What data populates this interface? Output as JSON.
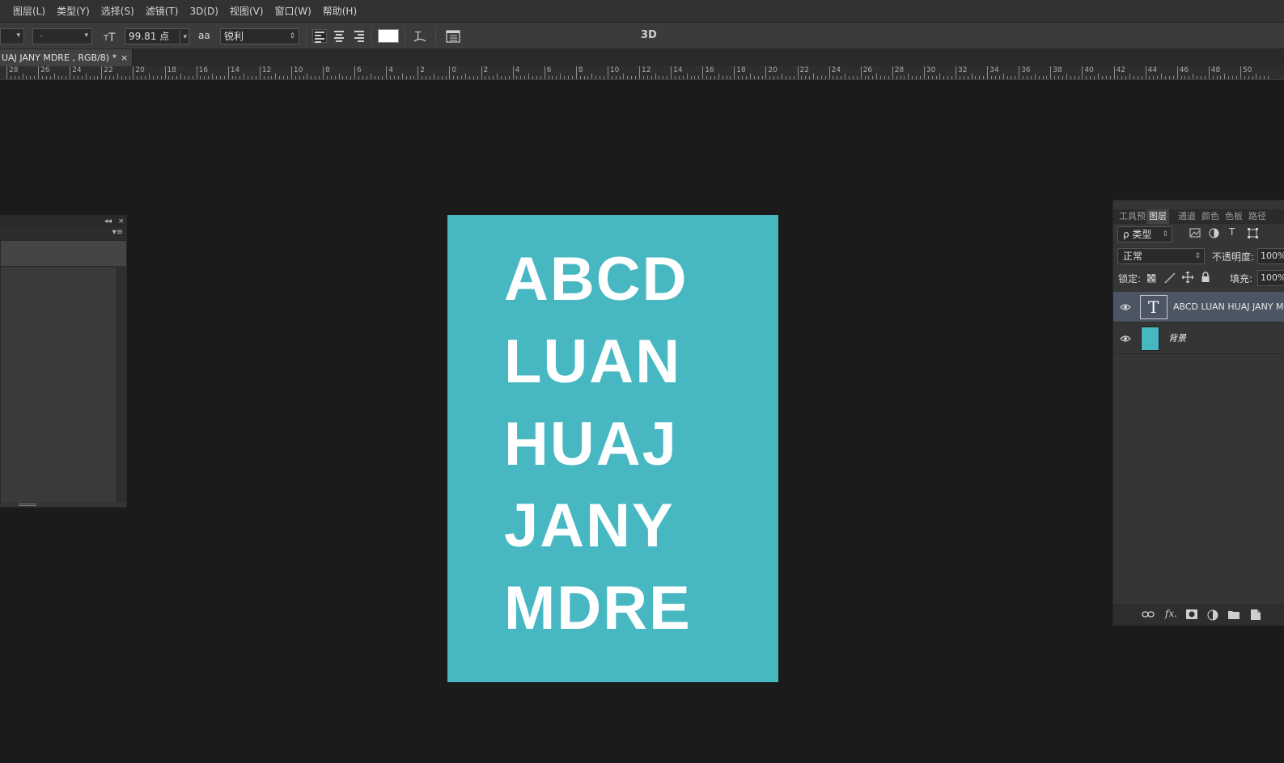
{
  "menubar": {
    "items": [
      "图层(L)",
      "类型(Y)",
      "选择(S)",
      "滤镜(T)",
      "3D(D)",
      "视图(V)",
      "窗口(W)",
      "帮助(H)"
    ]
  },
  "options": {
    "font_style_value": "-",
    "font_size_value": "99.81 点",
    "aa_icon": "aa",
    "antialias_value": "锐利",
    "text_color": "#ffffff",
    "mode_3d_label": "3D"
  },
  "document": {
    "tab_title": "UAJ JANY  MDRE , RGB/8) *",
    "tab_close": "×",
    "background_color": "#47b8c2",
    "lines": [
      "ABCD",
      "LUAN",
      "HUAJ",
      "JANY",
      "MDRE"
    ]
  },
  "ruler": {
    "labels": [
      "28",
      "26",
      "24",
      "22",
      "20",
      "18",
      "16",
      "14",
      "12",
      "10",
      "8",
      "6",
      "4",
      "2",
      "0",
      "2",
      "4",
      "6",
      "8",
      "10",
      "12",
      "14",
      "16",
      "18",
      "20",
      "22",
      "24",
      "26",
      "28",
      "30",
      "32",
      "34",
      "36",
      "38",
      "40",
      "42",
      "44",
      "46",
      "48",
      "50"
    ]
  },
  "left_panel": {
    "collapse_icon": "◂◂",
    "close_icon": "×",
    "menu_icon": "▾≡"
  },
  "layers_panel": {
    "tabs": [
      "工具预",
      "图层",
      "通道",
      "颜色",
      "色板",
      "路径"
    ],
    "active_tab_index": 1,
    "filter_label": "ρ 类型",
    "blend_mode": "正常",
    "opacity_label": "不透明度:",
    "opacity_value": "100%",
    "lock_label": "锁定:",
    "fill_label": "填充:",
    "fill_value": "100%",
    "layers": [
      {
        "name": "ABCD LUAN HUAJ JANY MDRE",
        "type": "text",
        "thumb_glyph": "T",
        "selected": true
      },
      {
        "name": "背景",
        "type": "fill",
        "thumb_color": "#47b8c2",
        "selected": false
      }
    ],
    "footer_icons": [
      "link-icon",
      "fx-icon",
      "mask-icon",
      "adjustment-icon",
      "folder-icon",
      "new-layer-icon"
    ],
    "footer_fx": "fx."
  }
}
